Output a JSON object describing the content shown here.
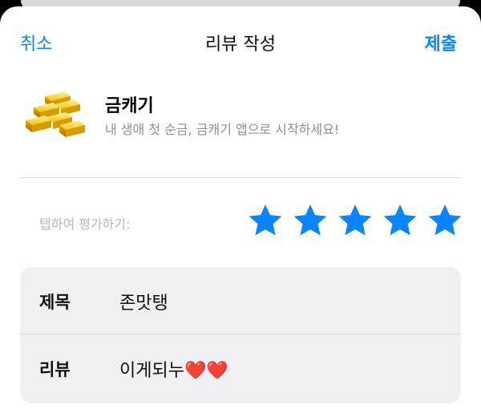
{
  "nav": {
    "cancel_label": "취소",
    "title": "리뷰 작성",
    "submit_label": "제출"
  },
  "app": {
    "name": "금캐기",
    "subtitle": "내 생애 첫 순금, 금캐기 앱으로 시작하세요!",
    "icon": "gold-bars-icon"
  },
  "rating": {
    "label": "탭하여 평가하기:",
    "value": 5,
    "max": 5,
    "star_color": "#0a84ff"
  },
  "form": {
    "title_label": "제목",
    "title_value": "존맛탱",
    "review_label": "리뷰",
    "review_value": "이게되누❤️❤️"
  },
  "colors": {
    "accent": "#0a84ff",
    "card_bg": "#efeff4",
    "gold": "#e8b300"
  }
}
